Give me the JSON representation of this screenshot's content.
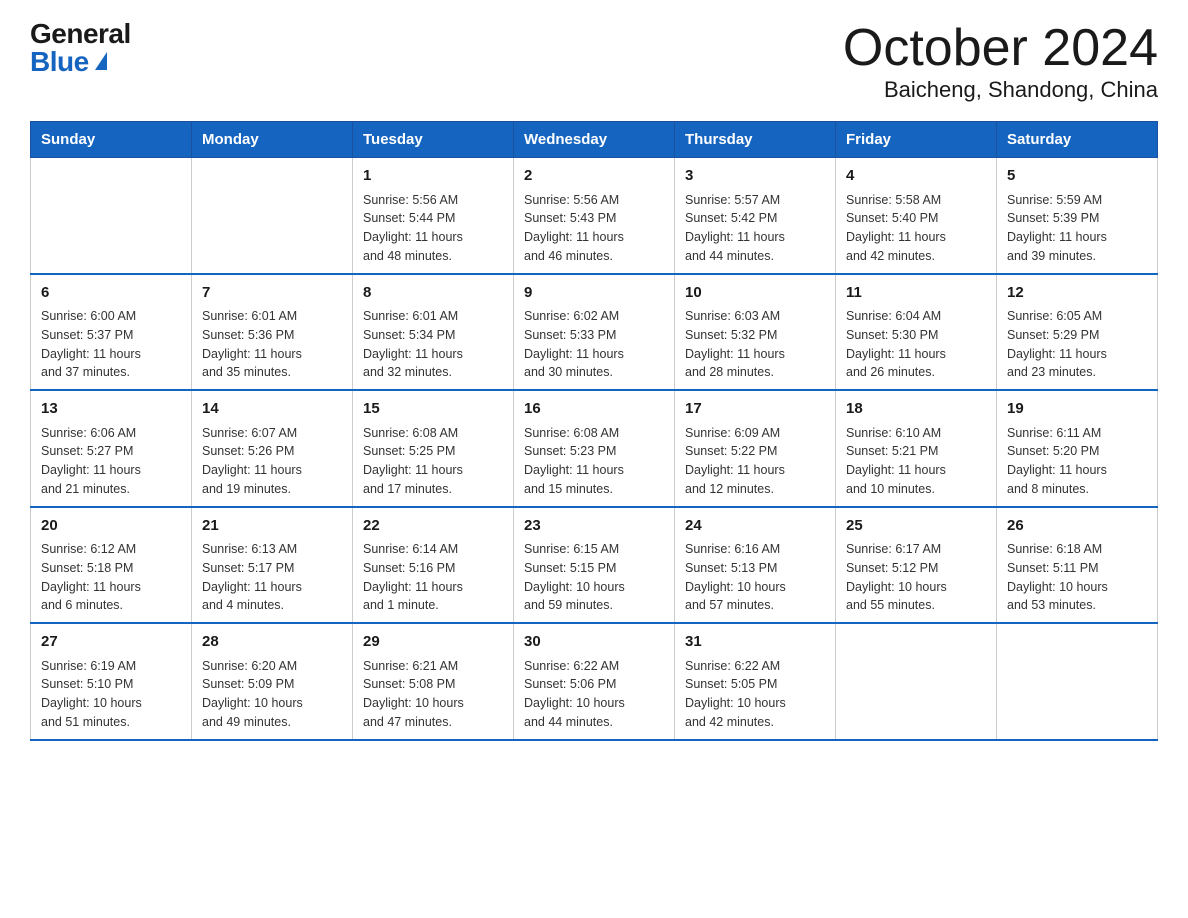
{
  "logo": {
    "general": "General",
    "blue": "Blue"
  },
  "title": "October 2024",
  "subtitle": "Baicheng, Shandong, China",
  "days_of_week": [
    "Sunday",
    "Monday",
    "Tuesday",
    "Wednesday",
    "Thursday",
    "Friday",
    "Saturday"
  ],
  "weeks": [
    [
      {
        "day": "",
        "info": ""
      },
      {
        "day": "",
        "info": ""
      },
      {
        "day": "1",
        "info": "Sunrise: 5:56 AM\nSunset: 5:44 PM\nDaylight: 11 hours\nand 48 minutes."
      },
      {
        "day": "2",
        "info": "Sunrise: 5:56 AM\nSunset: 5:43 PM\nDaylight: 11 hours\nand 46 minutes."
      },
      {
        "day": "3",
        "info": "Sunrise: 5:57 AM\nSunset: 5:42 PM\nDaylight: 11 hours\nand 44 minutes."
      },
      {
        "day": "4",
        "info": "Sunrise: 5:58 AM\nSunset: 5:40 PM\nDaylight: 11 hours\nand 42 minutes."
      },
      {
        "day": "5",
        "info": "Sunrise: 5:59 AM\nSunset: 5:39 PM\nDaylight: 11 hours\nand 39 minutes."
      }
    ],
    [
      {
        "day": "6",
        "info": "Sunrise: 6:00 AM\nSunset: 5:37 PM\nDaylight: 11 hours\nand 37 minutes."
      },
      {
        "day": "7",
        "info": "Sunrise: 6:01 AM\nSunset: 5:36 PM\nDaylight: 11 hours\nand 35 minutes."
      },
      {
        "day": "8",
        "info": "Sunrise: 6:01 AM\nSunset: 5:34 PM\nDaylight: 11 hours\nand 32 minutes."
      },
      {
        "day": "9",
        "info": "Sunrise: 6:02 AM\nSunset: 5:33 PM\nDaylight: 11 hours\nand 30 minutes."
      },
      {
        "day": "10",
        "info": "Sunrise: 6:03 AM\nSunset: 5:32 PM\nDaylight: 11 hours\nand 28 minutes."
      },
      {
        "day": "11",
        "info": "Sunrise: 6:04 AM\nSunset: 5:30 PM\nDaylight: 11 hours\nand 26 minutes."
      },
      {
        "day": "12",
        "info": "Sunrise: 6:05 AM\nSunset: 5:29 PM\nDaylight: 11 hours\nand 23 minutes."
      }
    ],
    [
      {
        "day": "13",
        "info": "Sunrise: 6:06 AM\nSunset: 5:27 PM\nDaylight: 11 hours\nand 21 minutes."
      },
      {
        "day": "14",
        "info": "Sunrise: 6:07 AM\nSunset: 5:26 PM\nDaylight: 11 hours\nand 19 minutes."
      },
      {
        "day": "15",
        "info": "Sunrise: 6:08 AM\nSunset: 5:25 PM\nDaylight: 11 hours\nand 17 minutes."
      },
      {
        "day": "16",
        "info": "Sunrise: 6:08 AM\nSunset: 5:23 PM\nDaylight: 11 hours\nand 15 minutes."
      },
      {
        "day": "17",
        "info": "Sunrise: 6:09 AM\nSunset: 5:22 PM\nDaylight: 11 hours\nand 12 minutes."
      },
      {
        "day": "18",
        "info": "Sunrise: 6:10 AM\nSunset: 5:21 PM\nDaylight: 11 hours\nand 10 minutes."
      },
      {
        "day": "19",
        "info": "Sunrise: 6:11 AM\nSunset: 5:20 PM\nDaylight: 11 hours\nand 8 minutes."
      }
    ],
    [
      {
        "day": "20",
        "info": "Sunrise: 6:12 AM\nSunset: 5:18 PM\nDaylight: 11 hours\nand 6 minutes."
      },
      {
        "day": "21",
        "info": "Sunrise: 6:13 AM\nSunset: 5:17 PM\nDaylight: 11 hours\nand 4 minutes."
      },
      {
        "day": "22",
        "info": "Sunrise: 6:14 AM\nSunset: 5:16 PM\nDaylight: 11 hours\nand 1 minute."
      },
      {
        "day": "23",
        "info": "Sunrise: 6:15 AM\nSunset: 5:15 PM\nDaylight: 10 hours\nand 59 minutes."
      },
      {
        "day": "24",
        "info": "Sunrise: 6:16 AM\nSunset: 5:13 PM\nDaylight: 10 hours\nand 57 minutes."
      },
      {
        "day": "25",
        "info": "Sunrise: 6:17 AM\nSunset: 5:12 PM\nDaylight: 10 hours\nand 55 minutes."
      },
      {
        "day": "26",
        "info": "Sunrise: 6:18 AM\nSunset: 5:11 PM\nDaylight: 10 hours\nand 53 minutes."
      }
    ],
    [
      {
        "day": "27",
        "info": "Sunrise: 6:19 AM\nSunset: 5:10 PM\nDaylight: 10 hours\nand 51 minutes."
      },
      {
        "day": "28",
        "info": "Sunrise: 6:20 AM\nSunset: 5:09 PM\nDaylight: 10 hours\nand 49 minutes."
      },
      {
        "day": "29",
        "info": "Sunrise: 6:21 AM\nSunset: 5:08 PM\nDaylight: 10 hours\nand 47 minutes."
      },
      {
        "day": "30",
        "info": "Sunrise: 6:22 AM\nSunset: 5:06 PM\nDaylight: 10 hours\nand 44 minutes."
      },
      {
        "day": "31",
        "info": "Sunrise: 6:22 AM\nSunset: 5:05 PM\nDaylight: 10 hours\nand 42 minutes."
      },
      {
        "day": "",
        "info": ""
      },
      {
        "day": "",
        "info": ""
      }
    ]
  ]
}
